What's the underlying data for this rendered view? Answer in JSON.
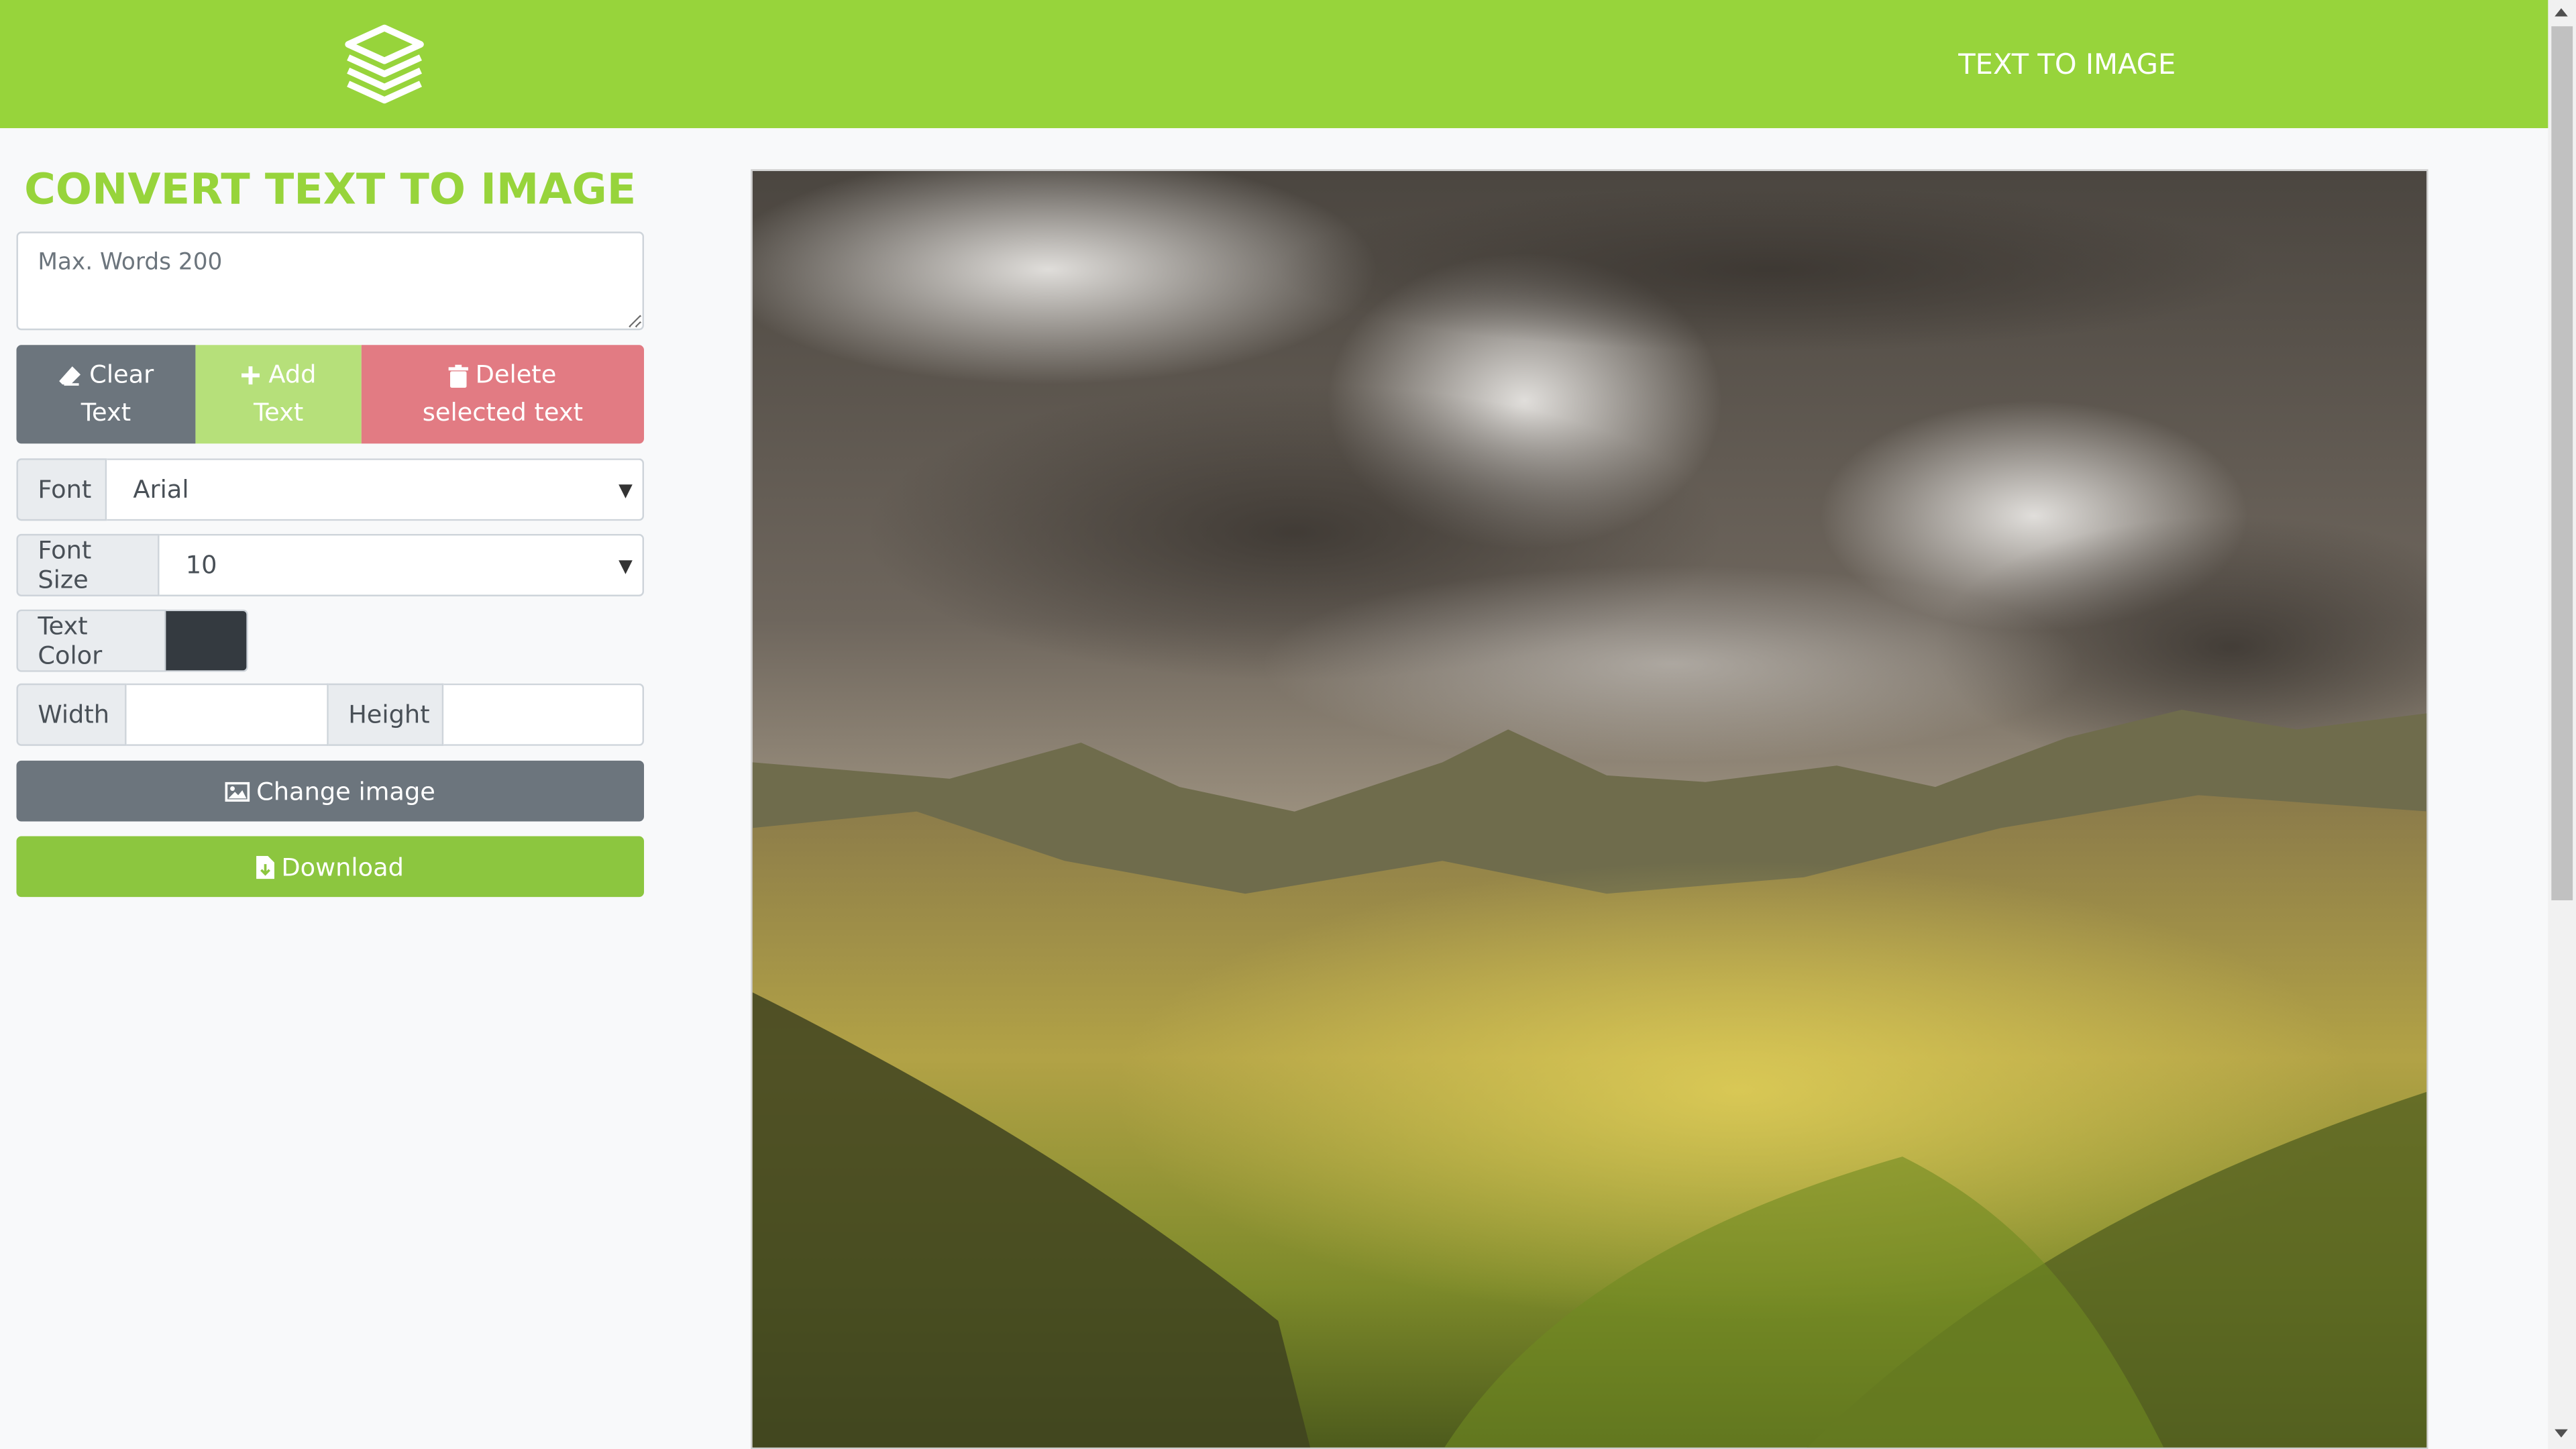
{
  "header": {
    "nav_link": "TEXT TO IMAGE"
  },
  "editor": {
    "title": "CONVERT TEXT TO IMAGE",
    "textarea_placeholder": "Max. Words 200",
    "buttons": {
      "clear": "Clear Text",
      "add": "Add Text",
      "delete": "Delete selected text"
    },
    "font": {
      "label": "Font",
      "value": "Arial"
    },
    "font_size": {
      "label": "Font Size",
      "value": "10"
    },
    "text_color": {
      "label": "Text Color",
      "value": "#343a40"
    },
    "width": {
      "label": "Width",
      "value": ""
    },
    "height": {
      "label": "Height",
      "value": ""
    },
    "change_image": "Change image",
    "download": "Download"
  },
  "colors": {
    "brand": "#97d43b",
    "clear_button": "#6c757d",
    "add_button": "#b6e07a",
    "delete_button": "#e27b83",
    "download_button": "#8cc63f"
  },
  "icons": {
    "logo": "brand-logo-icon",
    "clear": "eraser-icon",
    "add": "plus-icon",
    "delete": "trash-icon",
    "change_image": "image-icon",
    "download": "file-download-icon"
  }
}
